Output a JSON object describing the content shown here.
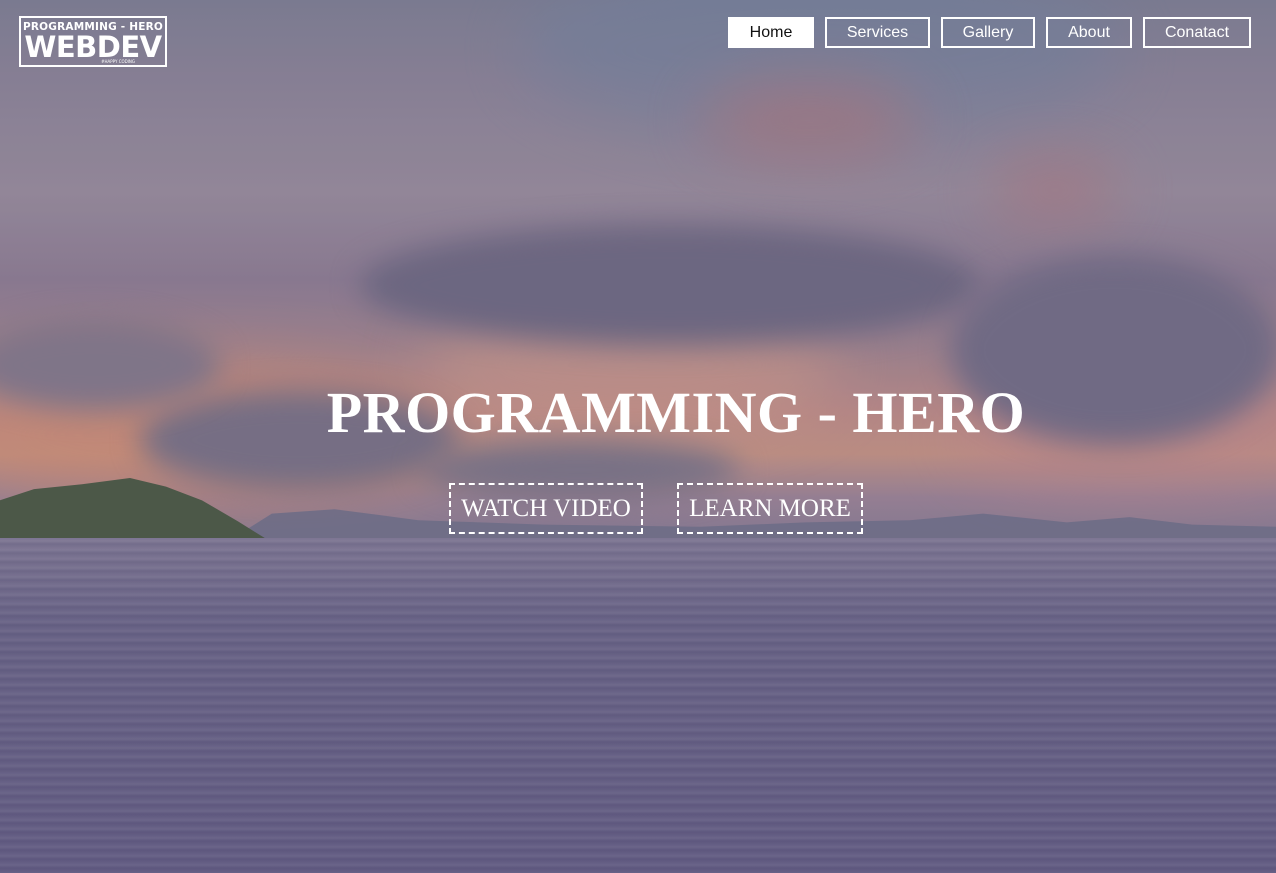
{
  "logo": {
    "top": "PROGRAMMING - HERO",
    "main": "WEBDEV",
    "sub": "#HAPPY CODING"
  },
  "nav": {
    "home": "Home",
    "services": "Services",
    "gallery": "Gallery",
    "about": "About",
    "contact": "Conatact",
    "active": "Home"
  },
  "hero": {
    "title": "PROGRAMMING - HERO",
    "watch_video": "WATCH VIDEO",
    "learn_more": "LEARN MORE"
  },
  "colors": {
    "text": "#ffffff",
    "active_nav_background": "#ffffff",
    "active_nav_text": "#111111"
  }
}
